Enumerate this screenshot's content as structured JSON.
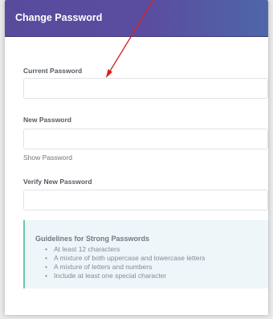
{
  "header": {
    "title": "Change Password"
  },
  "form": {
    "current_label": "Current Password",
    "current_value": "",
    "new_label": "New Password",
    "new_value": "",
    "show_password_label": "Show Password",
    "verify_label": "Verify New Password",
    "verify_value": ""
  },
  "guidelines": {
    "title": "Guidelines for Strong Passwords",
    "items": [
      "At least 12 characters",
      "A mixture of both uppercase and lowercase letters",
      "A mixture of letters and numbers",
      "Include at least one special character"
    ]
  },
  "colors": {
    "header": "#5a4da0",
    "guideline_accent": "#6ac6ae",
    "guideline_bg": "#eef6fa",
    "annotation_arrow": "#d62020"
  },
  "icons": [
    "red-annotation-arrow"
  ]
}
